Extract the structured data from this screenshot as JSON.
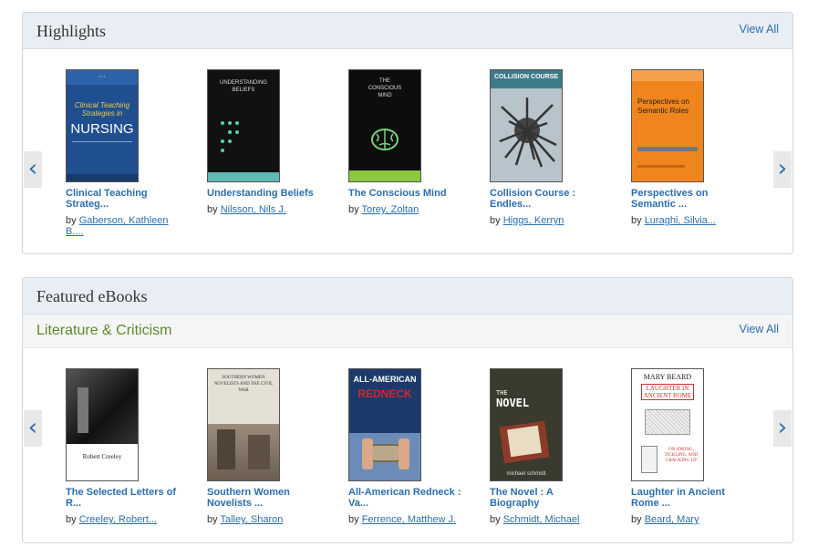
{
  "highlights": {
    "title": "Highlights",
    "view_all": "View All",
    "prev_arrow": "‹",
    "next_arrow": "›",
    "books": [
      {
        "title_line1": "Clinical Teaching",
        "title_line2": "Strateg...",
        "by": "by",
        "author_line1": "Gaberson, Kathleen",
        "author_line2": "B...."
      },
      {
        "title_line1": "Understanding Beliefs",
        "title_line2": "",
        "by": "by",
        "author_line1": "Nilsson, Nils J.",
        "author_line2": ""
      },
      {
        "title_line1": "The Conscious Mind",
        "title_line2": "",
        "by": "by",
        "author_line1": "Torey, Zoltan",
        "author_line2": ""
      },
      {
        "title_line1": "Collision Course :",
        "title_line2": "Endles...",
        "by": "by",
        "author_line1": "Higgs, Kerryn",
        "author_line2": ""
      },
      {
        "title_line1": "Perspectives on",
        "title_line2": "Semantic ...",
        "by": "by",
        "author_line1": "Luraghi, Silvia...",
        "author_line2": ""
      }
    ]
  },
  "featured": {
    "title": "Featured eBooks",
    "category": "Literature & Criticism",
    "view_all": "View All",
    "prev_arrow": "‹",
    "next_arrow": "›",
    "books": [
      {
        "title_line1": "The Selected Letters of",
        "title_line2": "R...",
        "by": "by",
        "author_line1": "Creeley, Robert...",
        "author_line2": ""
      },
      {
        "title_line1": "Southern Women",
        "title_line2": "Novelists ...",
        "by": "by",
        "author_line1": "Talley, Sharon",
        "author_line2": ""
      },
      {
        "title_line1": "All-American Redneck :",
        "title_line2": "Va...",
        "by": "by",
        "author_line1": "Ferrence, Matthew J.",
        "author_line2": ""
      },
      {
        "title_line1": "The Novel : A",
        "title_line2": "Biography",
        "by": "by",
        "author_line1": "Schmidt, Michael",
        "author_line2": ""
      },
      {
        "title_line1": "Laughter in Ancient",
        "title_line2": "Rome ...",
        "by": "by",
        "author_line1": "Beard, Mary",
        "author_line2": ""
      }
    ]
  },
  "covers": {
    "nursing": {
      "text_top": "Clinical Teaching Strategies in",
      "text_main": "NURSING",
      "bg": "#1f4f8f"
    },
    "beliefs": {
      "text": "UNDERSTANDING BELIEFS",
      "bg": "#111111",
      "dot": "#5ad1a8"
    },
    "mind": {
      "text": "THE CONSCIOUS MIND",
      "bg": "#0d0d0d",
      "brain": "#7ccf7a",
      "band": "#8dc63f"
    },
    "collision": {
      "text": "COLLISION COURSE",
      "bg": "#b8c4cc"
    },
    "semantic": {
      "text": "Perspectives on Semantic Roles",
      "bg": "#f0851e"
    },
    "letters": {
      "text": "Robert Creeley",
      "bg": "#ffffff"
    },
    "southern": {
      "text": "SOUTHERN WOMEN NOVELISTS AND THE CIVIL WAR",
      "bg": "#e4e0d6"
    },
    "redneck": {
      "text_top": "ALL-AMERICAN",
      "text_main": "REDNECK",
      "bg": "#1c3a6b",
      "accent": "#d4262c"
    },
    "novel": {
      "text_top": "THE",
      "text_main": "NOVEL",
      "author": "michael schmidt",
      "bg": "#3a3a2e"
    },
    "laughter": {
      "text_top": "MARY BEARD",
      "text_main": "LAUGHTER IN ANCIENT ROME",
      "text_sub": "ON JOKING, TICKLING, AND CRACKING UP",
      "bg": "#ffffff",
      "accent": "#c8312b"
    }
  }
}
